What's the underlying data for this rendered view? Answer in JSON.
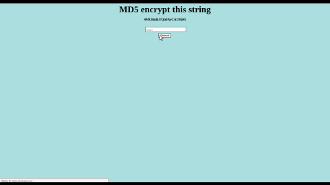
{
  "page": {
    "title": "MD5 encrypt this string",
    "target_string": "4MC8mKUQn0AyCAUHj45",
    "background_color": "#aadedf"
  },
  "form": {
    "input_value": "",
    "input_placeholder": "hash",
    "submit_label": "Submit"
  },
  "status_bar": {
    "text": "Waiting for hurlee.herokuapp.com..."
  },
  "cursor": {
    "icon": "arrow-pointer-icon"
  }
}
